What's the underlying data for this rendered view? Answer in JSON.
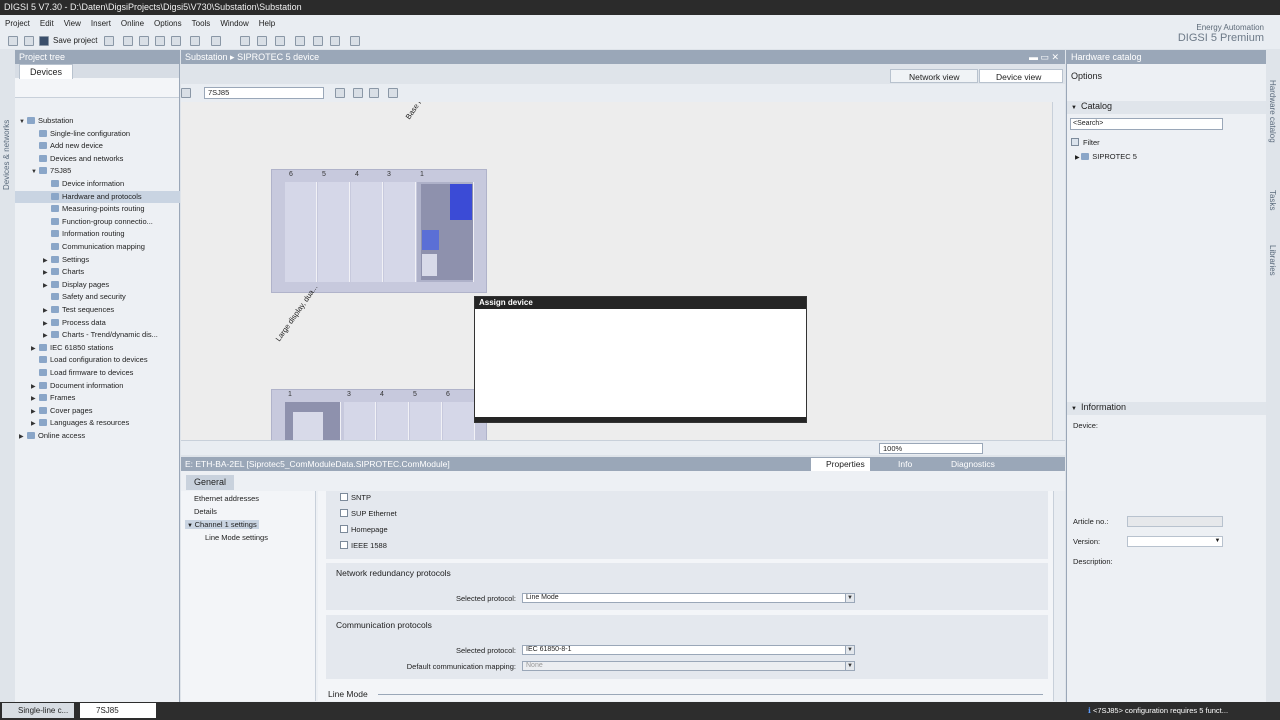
{
  "window": {
    "title": "DIGSI 5 V7.30 - D:\\Daten\\DigsiProjects\\Digsi5\\V730\\Substation\\Substation"
  },
  "menu": [
    "Project",
    "Edit",
    "View",
    "Insert",
    "Online",
    "Options",
    "Tools",
    "Window",
    "Help"
  ],
  "toolbar": {
    "save_label": "Save project"
  },
  "brand": {
    "line1": "Energy Automation",
    "line2": "DIGSI 5 Premium"
  },
  "left_vtab": "Devices & networks",
  "project_tree": {
    "header": "Project tree",
    "tab": "Devices",
    "items": [
      {
        "label": "Substation",
        "level": 0,
        "expander": "▼"
      },
      {
        "label": "Single-line configuration",
        "level": 1,
        "expander": ""
      },
      {
        "label": "Add new device",
        "level": 1,
        "expander": ""
      },
      {
        "label": "Devices and networks",
        "level": 1,
        "expander": ""
      },
      {
        "label": "7SJ85",
        "level": 1,
        "expander": "▼"
      },
      {
        "label": "Device information",
        "level": 2,
        "expander": ""
      },
      {
        "label": "Hardware and protocols",
        "level": 2,
        "expander": "",
        "selected": true
      },
      {
        "label": "Measuring-points routing",
        "level": 2,
        "expander": ""
      },
      {
        "label": "Function-group connectio...",
        "level": 2,
        "expander": ""
      },
      {
        "label": "Information routing",
        "level": 2,
        "expander": ""
      },
      {
        "label": "Communication mapping",
        "level": 2,
        "expander": ""
      },
      {
        "label": "Settings",
        "level": 2,
        "expander": "▶"
      },
      {
        "label": "Charts",
        "level": 2,
        "expander": "▶"
      },
      {
        "label": "Display pages",
        "level": 2,
        "expander": "▶"
      },
      {
        "label": "Safety and security",
        "level": 2,
        "expander": ""
      },
      {
        "label": "Test sequences",
        "level": 2,
        "expander": "▶"
      },
      {
        "label": "Process data",
        "level": 2,
        "expander": "▶"
      },
      {
        "label": "Charts - Trend/dynamic dis...",
        "level": 2,
        "expander": "▶"
      },
      {
        "label": "IEC 61850 stations",
        "level": 1,
        "expander": "▶"
      },
      {
        "label": "Load configuration to devices",
        "level": 1,
        "expander": ""
      },
      {
        "label": "Load firmware to devices",
        "level": 1,
        "expander": ""
      },
      {
        "label": "Document information",
        "level": 1,
        "expander": "▶"
      },
      {
        "label": "Frames",
        "level": 1,
        "expander": "▶"
      },
      {
        "label": "Cover pages",
        "level": 1,
        "expander": "▶"
      },
      {
        "label": "Languages & resources",
        "level": 1,
        "expander": "▶"
      },
      {
        "label": "Online access",
        "level": 0,
        "expander": "▶"
      }
    ]
  },
  "editor": {
    "breadcrumb": {
      "root": "Substation",
      "sep": "▸",
      "current": "SIPROTEC 5 device"
    },
    "network_view": "Network view",
    "device_view": "Device view",
    "device_select": "7SJ85",
    "zoom": "100%",
    "rack1": {
      "label": "Base module inclu...",
      "slots": [
        "6",
        "5",
        "4",
        "3",
        "1"
      ]
    },
    "rack2": {
      "label": "Large display, dua...",
      "slots": [
        "1",
        "3",
        "4",
        "5",
        "6"
      ]
    },
    "dialog": {
      "title": "Assign device"
    }
  },
  "properties": {
    "object_title": "E: ETH-BA-2EL [Siprotec5_ComModuleData.SIPROTEC.ComModule]",
    "tabs": [
      "Properties",
      "Info",
      "Diagnostics"
    ],
    "general_tab": "General",
    "nav": [
      "Ethernet addresses",
      "Details",
      "Channel 1 settings",
      "Line Mode settings"
    ],
    "checkboxes": [
      "SNTP",
      "SUP Ethernet",
      "Homepage",
      "IEEE 1588"
    ],
    "network_redundancy": {
      "title": "Network redundancy protocols",
      "label": "Selected protocol:",
      "value": "Line Mode"
    },
    "communication": {
      "title": "Communication protocols",
      "label": "Selected protocol:",
      "value": "IEC 61850-8-1",
      "mapping_label": "Default communication mapping:",
      "mapping_value": "None"
    },
    "line_mode": "Line Mode"
  },
  "catalog": {
    "header": "Hardware catalog",
    "options": "Options",
    "catalog_title": "Catalog",
    "search_placeholder": "<Search>",
    "filter": "Filter",
    "tree_item": "SIPROTEC 5",
    "information": "Information",
    "device_label": "Device:",
    "article_label": "Article no.:",
    "version_label": "Version:",
    "description_label": "Description:"
  },
  "right_vtabs": [
    "Hardware catalog",
    "Tasks",
    "Libraries"
  ],
  "statusbar": {
    "tasks": [
      "Single-line c...",
      "7SJ85"
    ],
    "message": "<7SJ85> configuration requires 5 funct..."
  }
}
